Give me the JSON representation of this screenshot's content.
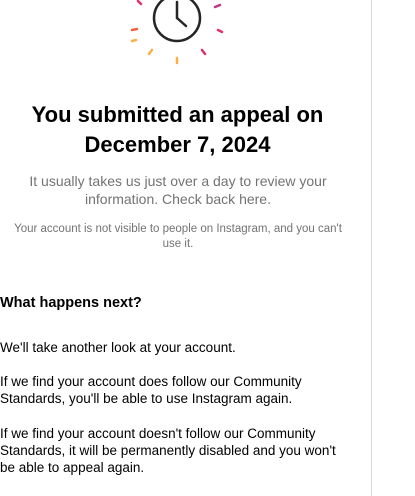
{
  "appeal": {
    "title": "You submitted an appeal on December 7, 2024",
    "subtitle": "It usually takes us just over a day to review your information. Check back here.",
    "account_note": "Your account is not visible to people on Instagram, and you can't use it."
  },
  "next_steps": {
    "heading": "What happens next?",
    "paragraphs": [
      "We'll take another look at your account.",
      "If we find your account does follow our Community Standards, you'll be able to use Instagram again.",
      "If we find your account doesn't follow our Community Standards, it will be permanently disabled and you won't be able to appeal again."
    ]
  },
  "illustration": {
    "icon": "clock-icon",
    "ray_colors": [
      "#e1306c",
      "#f56040",
      "#fcaf45",
      "#c13584",
      "#833ab4"
    ]
  }
}
